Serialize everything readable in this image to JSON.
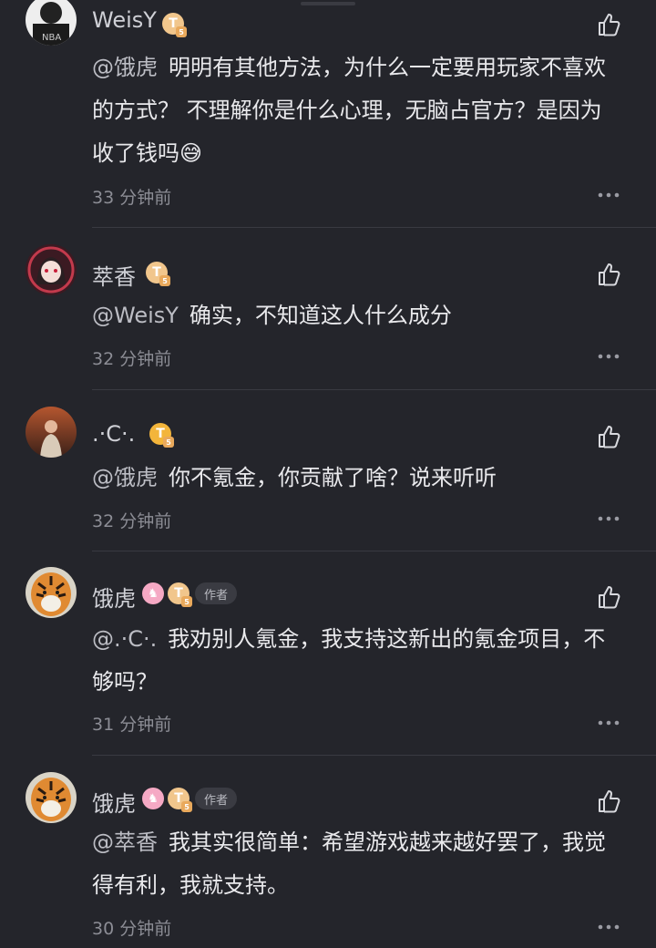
{
  "comments": [
    {
      "name": "WeisY",
      "mention": "@饿虎",
      "text_lines": [
        "明明有其他方法，为什么一定要用玩家不喜欢",
        "的方式？ 不理解你是什么心理，无脑占官方？是因为",
        "收了钱吗😅"
      ],
      "time": "33 分钟前"
    },
    {
      "name": "萃香",
      "mention": "@WeisY",
      "text_lines": [
        "确实，不知道这人什么成分"
      ],
      "time": "32 分钟前"
    },
    {
      "name": ".·C·.",
      "mention": "@饿虎",
      "text_lines": [
        "你不氪金，你贡献了啥？说来听听"
      ],
      "time": "32 分钟前"
    },
    {
      "name": "饿虎",
      "author_tag": "作者",
      "mention": "@.·C·.",
      "text_lines": [
        "我劝别人氪金，我支持这新出的氪金项目，不",
        "够吗？"
      ],
      "time": "31 分钟前"
    },
    {
      "name": "饿虎",
      "author_tag": "作者",
      "mention": "@萃香",
      "text_lines": [
        "我其实很简单：希望游戏越来越好罢了，我觉",
        "得有利，我就支持。"
      ],
      "time": "30 分钟前"
    }
  ],
  "icons": {
    "like": "thumbs-up-icon",
    "more": "more-dots-icon",
    "level_badge": "T",
    "level_sub": "5"
  }
}
